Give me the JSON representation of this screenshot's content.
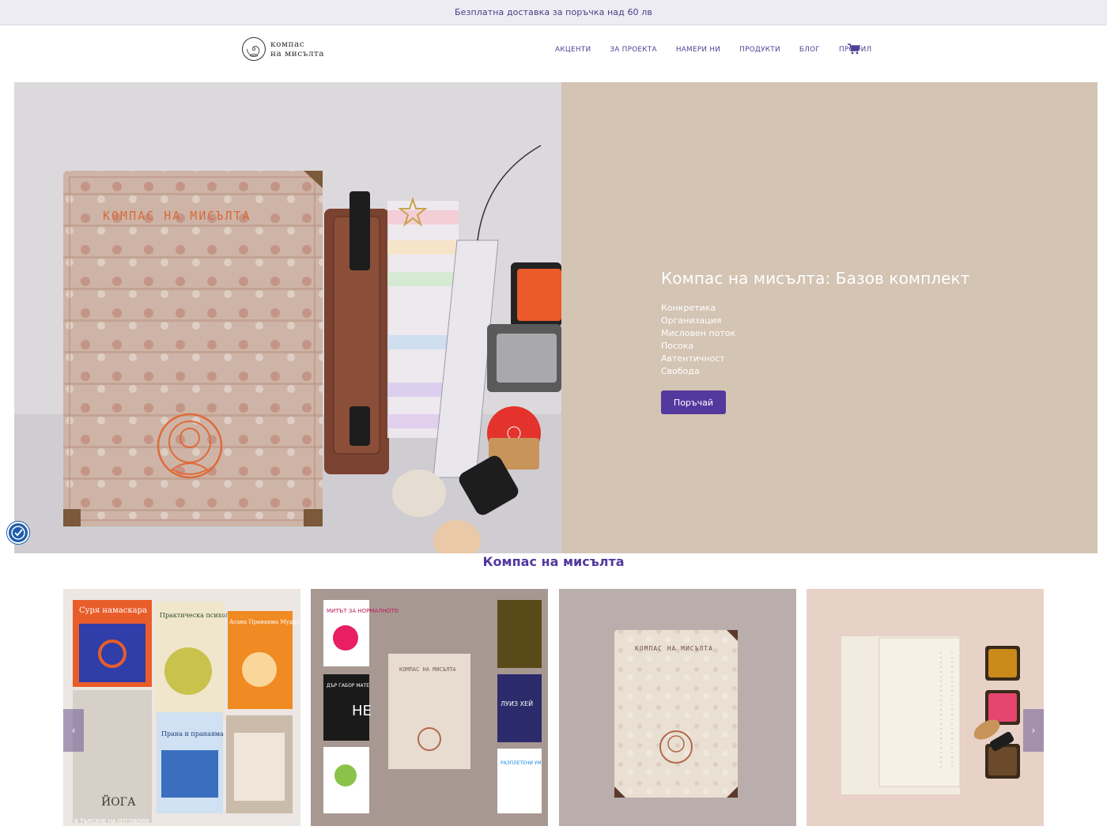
{
  "announcement": "Безплатна доставка за поръчка над 60 лв",
  "brand": {
    "line1": "компас",
    "line2": "на мисълта",
    "logo_icon": "spiral-lotus-logo"
  },
  "nav": {
    "items": [
      "АКЦЕНТИ",
      "ЗА ПРОЕКТА",
      "НАМЕРИ НИ",
      "ПРОДУКТИ",
      "БЛОГ",
      "ПРОФИЛ"
    ],
    "cart_icon": "cart-icon"
  },
  "hero": {
    "title": "Компас на мисълта: Базов комплект",
    "features": [
      "Конкретика",
      "Организация",
      "Мисловен поток",
      "Посока",
      "Автентичност",
      "Свобода"
    ],
    "cta": "Поръчай",
    "image_caption": "КОМПАС НА МИСЪЛТА"
  },
  "section": {
    "title": "Компас на мисълта"
  },
  "cards": [
    {
      "name": "yoga-books-set",
      "covers": [
        "Суря намаскара",
        "Практическа психология на йога",
        "Асана Пранаяма Мудра Бандха",
        "Прана и пранаяма",
        "ЙОГА",
        "В ТЪРСЕНЕ НА ОТГОВОРИ"
      ]
    },
    {
      "name": "mate-hay-books-set",
      "covers": [
        "МИТЪТ ЗА НОРМАЛНОТО",
        "ДЪР ГАБОР МАТЕ",
        "НЕ",
        "ЛУИЗ ХЕЙ",
        "РАЗПЛЕТЕНИ УМ"
      ]
    },
    {
      "name": "notebook-box",
      "covers": [
        "КОМПАС НА МИСЪЛТА"
      ]
    },
    {
      "name": "planner-stamps",
      "covers": []
    }
  ],
  "colors": {
    "accent": "#53389e",
    "hero_bg": "#d4c4b3",
    "topbar_bg": "#edecf4"
  }
}
